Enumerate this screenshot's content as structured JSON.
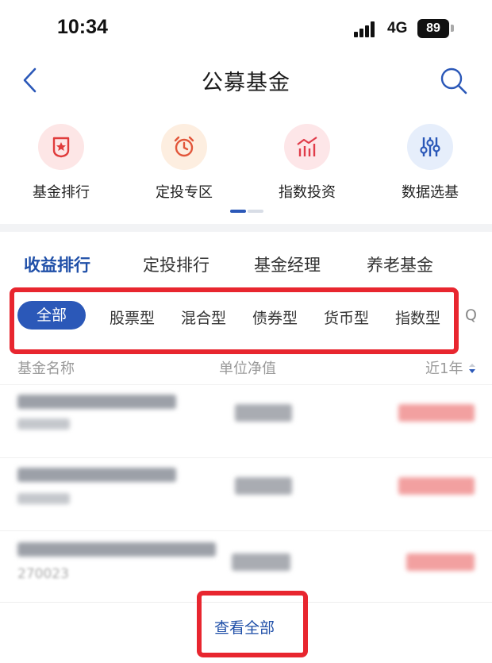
{
  "status_bar": {
    "time": "10:34",
    "network": "4G",
    "battery": "89"
  },
  "header": {
    "title": "公募基金"
  },
  "quick_entries": [
    {
      "label": "基金排行",
      "icon": "badge-star-icon",
      "bg": "#fde6e6",
      "color": "#e03c3c"
    },
    {
      "label": "定投专区",
      "icon": "alarm-clock-icon",
      "bg": "#fdeee0",
      "color": "#e2563a"
    },
    {
      "label": "指数投资",
      "icon": "bar-trend-icon",
      "bg": "#fde6e8",
      "color": "#e03c4a"
    },
    {
      "label": "数据选基",
      "icon": "sliders-icon",
      "bg": "#e6eefb",
      "color": "#2b58b8"
    }
  ],
  "tabs": [
    {
      "label": "收益排行",
      "active": true
    },
    {
      "label": "定投排行",
      "active": false
    },
    {
      "label": "基金经理",
      "active": false
    },
    {
      "label": "养老基金",
      "active": false
    }
  ],
  "chips": [
    {
      "label": "全部",
      "active": true
    },
    {
      "label": "股票型",
      "active": false
    },
    {
      "label": "混合型",
      "active": false
    },
    {
      "label": "债券型",
      "active": false
    },
    {
      "label": "货币型",
      "active": false
    },
    {
      "label": "指数型",
      "active": false
    },
    {
      "label": "Q",
      "active": false
    }
  ],
  "table": {
    "columns": [
      "基金名称",
      "单位净值",
      "近1年"
    ],
    "rows": [
      {
        "code": ""
      },
      {
        "code": ""
      },
      {
        "code": "270023"
      }
    ]
  },
  "view_all_label": "查看全部",
  "colors": {
    "accent": "#2b58b8",
    "highlight": "#e8262f",
    "gain": "#f2a0a0"
  }
}
